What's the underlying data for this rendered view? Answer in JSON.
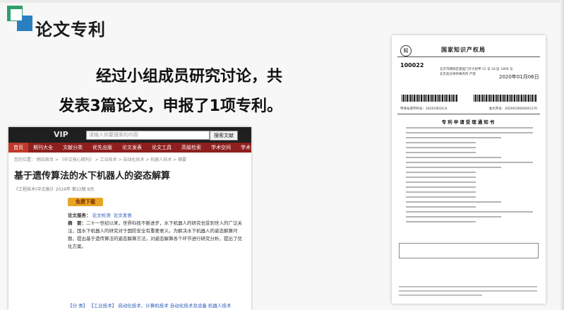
{
  "slide": {
    "title": "论文专利",
    "body_line1": "经过小组成员研究讨论，共",
    "body_line2": "发表3篇论文，申报了1项专利。"
  },
  "web_screenshot": {
    "logo": "VIP",
    "search_placeholder": "请输入你要搜索的内容",
    "search_button": "搜索文献",
    "nav": [
      "首页",
      "期刊大全",
      "文献分类",
      "优先出版",
      "论文发表",
      "论文工具",
      "高级检索",
      "学术空间",
      "学术名刊"
    ],
    "breadcrumb": "您的位置： 网站首页 > 《中文核心期刊》 > 工业技术 > 自动化技术 > 机器人技术 > 摘要",
    "paper_title": "基于遗传算法的水下机器人的姿态解算",
    "meta": "《工程技术(中文版)》2019年 第22期 8页",
    "download": "免费下载",
    "abstract_label": "论文服务：",
    "services": [
      "论文检测",
      "论文发表"
    ],
    "abstract_head": "摘　要：",
    "abstract_text": "二十一世纪以来，世界科技不断进步，水下机器人的研究也受到世人的广泛关注，国水下机器人的研究对于国防安全有重要意义。为解决水下机器人的姿态解算问题，提出基于遗传算法的姿态解算方法，对姿态解算各个环节进行研究分析，提出了优化方案。",
    "keywords_label": "【分 类】",
    "keywords": [
      "【工业技术】",
      "自动化技术、计算机技术",
      "自动化技术及设备",
      "机器人技术"
    ]
  },
  "patent_doc": {
    "emblem": "知",
    "agency": "国家知识产权局",
    "post_number": "100022",
    "address_lines": [
      "北京市朝阳区建国门外大街甲 15 号 18 层 1806 号",
      "北京高文律师事务所 严登"
    ],
    "date": "2020年01月06日",
    "id_left": "申请号或专利号：202010016.8",
    "id_right": "发文序号：2020010600041270",
    "doc_title": "专利申请受理通知书"
  }
}
